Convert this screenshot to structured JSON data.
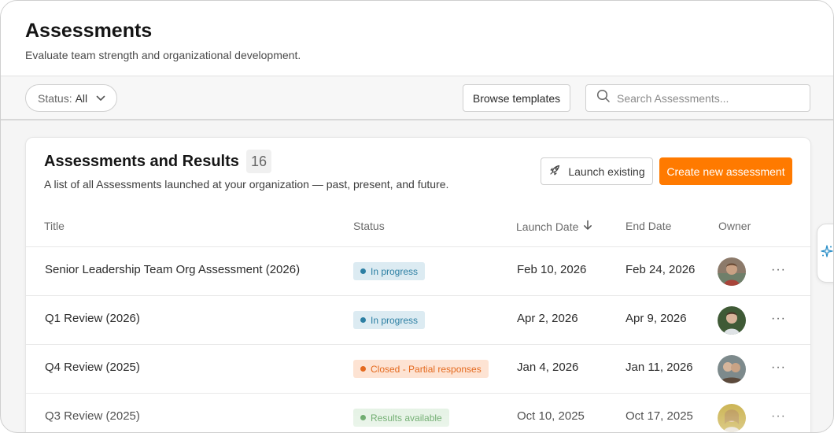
{
  "header": {
    "title": "Assessments",
    "subtitle": "Evaluate team strength and organizational development."
  },
  "toolbar": {
    "status_filter_label": "Status:",
    "status_filter_value": "All",
    "browse_label": "Browse templates",
    "search_placeholder": "Search Assessments..."
  },
  "card": {
    "title": "Assessments and Results",
    "count": "16",
    "description": "A list of all Assessments launched at your organization — past, present, and future.",
    "launch_existing_label": "Launch existing",
    "create_label": "Create new assessment"
  },
  "table": {
    "columns": {
      "title": "Title",
      "status": "Status",
      "launch_date": "Launch Date",
      "end_date": "End Date",
      "owner": "Owner"
    },
    "rows": [
      {
        "title": "Senior Leadership Team Org Assessment (2026)",
        "status": "In progress",
        "launch_date": "Feb 10, 2026",
        "end_date": "Feb 24, 2026",
        "more": "···"
      },
      {
        "title": "Q1 Review (2026)",
        "status": "In progress",
        "launch_date": "Apr 2, 2026",
        "end_date": "Apr 9, 2026",
        "more": "···"
      },
      {
        "title": "Q4 Review (2025)",
        "status": "Closed - Partial responses",
        "launch_date": "Jan 4, 2026",
        "end_date": "Jan 11, 2026",
        "more": "···"
      },
      {
        "title": "Q3 Review (2025)",
        "status": "Results available",
        "launch_date": "Oct 10, 2025",
        "end_date": "Oct 17, 2025",
        "more": "···"
      }
    ]
  },
  "colors": {
    "accent": "#ff7a00",
    "in_progress_bg": "#dcebf2",
    "in_progress_fg": "#2c7fa3",
    "closed_bg": "#fde3d3",
    "closed_fg": "#e46a1f",
    "results_bg": "#e2f1e2",
    "results_fg": "#4f9a4f"
  },
  "icons": {
    "status_chevron": "chevron-down-icon",
    "search": "search-icon",
    "launch": "rocket-icon",
    "sort": "arrow-down-icon",
    "side_tab": "sparkle-icon",
    "row_menu": "more-horizontal-icon"
  }
}
